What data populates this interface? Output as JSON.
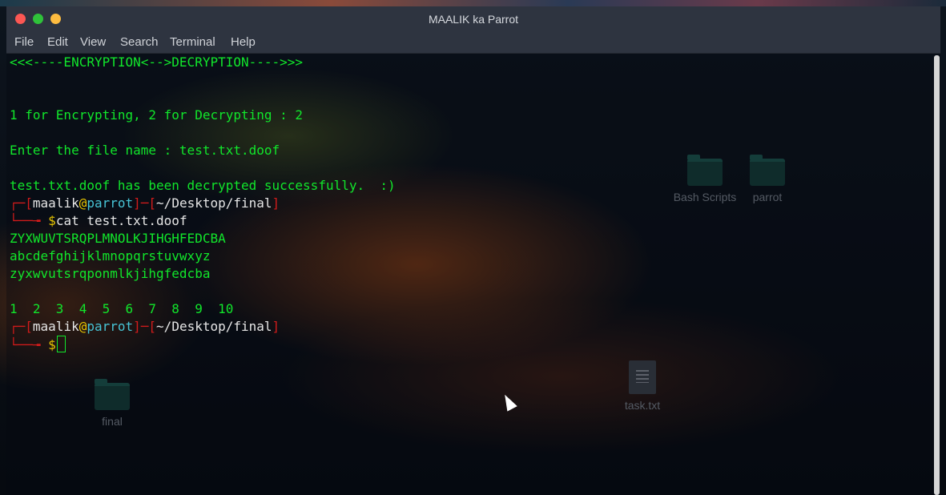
{
  "window": {
    "title": "MAALIK ka Parrot",
    "menu": [
      "File",
      "Edit",
      "View",
      "Search",
      "Terminal",
      "Help"
    ]
  },
  "terminal": {
    "banner": "<<<----ENCRYPTION<-->DECRYPTION---->>>",
    "choice_line": "1 for Encrypting, 2 for Decrypting : 2",
    "file_prompt_line": "Enter the file name : test.txt.doof",
    "success_line": "test.txt.doof has been decrypted successfully.  :)",
    "prompt": {
      "user": "maalik",
      "at": "@",
      "host": "parrot",
      "path": "~/Desktop/final",
      "symbol": "$"
    },
    "command": "cat test.txt.doof",
    "output": [
      "ZYXWUVTSRQPLMNOLKJIHGHFEDCBA",
      "abcdefghijklmnopqrstuvwxyz",
      "zyxwvutsrqponmlkjihgfedcba",
      "",
      "1  2  3  4  5  6  7  8  9  10"
    ]
  },
  "desktop": {
    "icons": [
      {
        "label": "Bash Scripts",
        "type": "folder"
      },
      {
        "label": "parrot",
        "type": "folder"
      },
      {
        "label": "final",
        "type": "folder"
      },
      {
        "label": "task.txt",
        "type": "file"
      }
    ]
  },
  "colors": {
    "terminal_text": "#11e62b",
    "prompt_bracket": "#d11b1b",
    "prompt_host": "#47c4d6",
    "titlebar": "#2e3440"
  }
}
